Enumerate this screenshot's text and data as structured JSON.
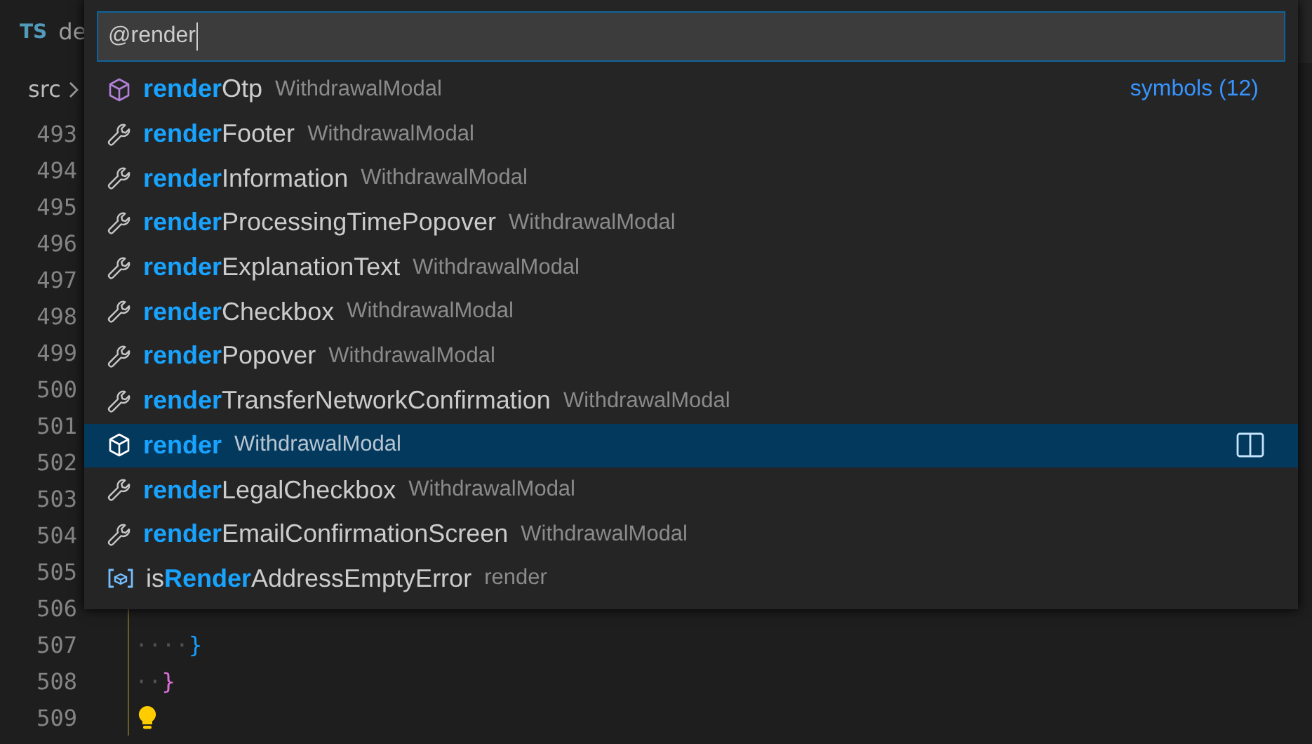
{
  "tab": {
    "badge": "TS",
    "title": "de"
  },
  "breadcrumb": [
    "src"
  ],
  "editor": {
    "lines": [
      {
        "number": "493"
      },
      {
        "number": "494"
      },
      {
        "number": "495"
      },
      {
        "number": "496"
      },
      {
        "number": "497"
      },
      {
        "number": "498"
      },
      {
        "number": "499"
      },
      {
        "number": "500"
      },
      {
        "number": "501"
      },
      {
        "number": "502"
      },
      {
        "number": "503"
      },
      {
        "number": "504"
      },
      {
        "number": "505"
      },
      {
        "number": "506"
      },
      {
        "number": "507",
        "tokens": [
          {
            "kind": "whitespace",
            "text": "····"
          },
          {
            "kind": "brace",
            "text": "}"
          }
        ]
      },
      {
        "number": "508",
        "tokens": [
          {
            "kind": "whitespace",
            "text": "··"
          },
          {
            "kind": "brace2",
            "text": "}"
          }
        ]
      },
      {
        "number": "509",
        "lightbulb": true
      }
    ]
  },
  "quick_open": {
    "query": "@render",
    "items": [
      {
        "kind": "class",
        "match": "render",
        "after": "Otp",
        "detail": "WithdrawalModal",
        "selected": false,
        "hint": "symbols (12)"
      },
      {
        "kind": "method",
        "match": "render",
        "after": "Footer",
        "detail": "WithdrawalModal",
        "selected": false
      },
      {
        "kind": "method",
        "match": "render",
        "after": "Information",
        "detail": "WithdrawalModal",
        "selected": false
      },
      {
        "kind": "method",
        "match": "render",
        "after": "ProcessingTimePopover",
        "detail": "WithdrawalModal",
        "selected": false
      },
      {
        "kind": "method",
        "match": "render",
        "after": "ExplanationText",
        "detail": "WithdrawalModal",
        "selected": false
      },
      {
        "kind": "method",
        "match": "render",
        "after": "Checkbox",
        "detail": "WithdrawalModal",
        "selected": false
      },
      {
        "kind": "method",
        "match": "render",
        "after": "Popover",
        "detail": "WithdrawalModal",
        "selected": false
      },
      {
        "kind": "method",
        "match": "render",
        "after": "TransferNetworkConfirmation",
        "detail": "WithdrawalModal",
        "selected": false
      },
      {
        "kind": "class",
        "match": "render",
        "detail": "WithdrawalModal",
        "selected": true
      },
      {
        "kind": "method",
        "match": "render",
        "after": "LegalCheckbox",
        "detail": "WithdrawalModal",
        "selected": false
      },
      {
        "kind": "method",
        "match": "render",
        "after": "EmailConfirmationScreen",
        "detail": "WithdrawalModal",
        "selected": false
      },
      {
        "kind": "variable",
        "before": "is",
        "match": "Render",
        "after": "AddressEmptyError",
        "detail": "render",
        "selected": false
      }
    ]
  }
}
